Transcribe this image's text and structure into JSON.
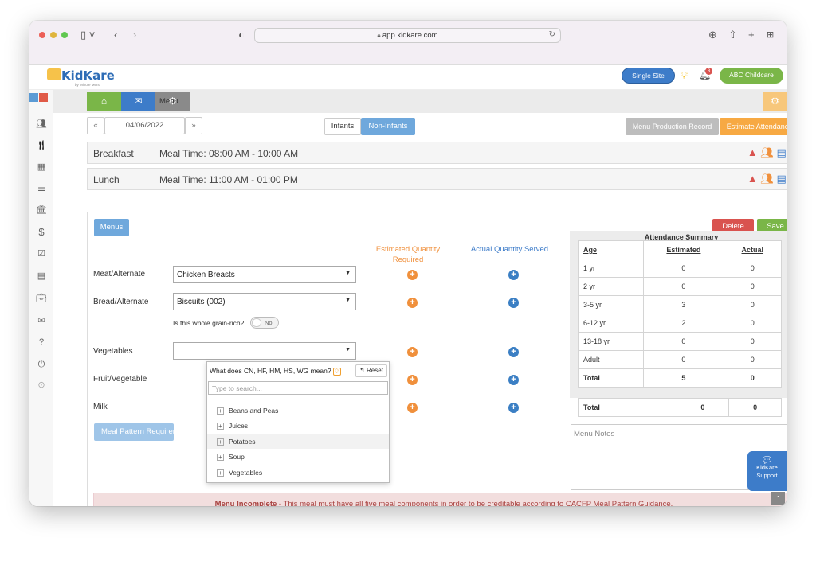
{
  "browser": {
    "url": "app.kidkare.com"
  },
  "header": {
    "logo": "KidKare",
    "logo_sub": "by Minute Menu",
    "single_site_label": "Single Site",
    "notification_count": "3",
    "childcare_label": "ABC Childcare"
  },
  "nav": {
    "menu_label": "Menu"
  },
  "toolbar": {
    "prev": "«",
    "date": "04/06/2022",
    "next": "»",
    "infants_label": "Infants",
    "noninfants_label": "Non-Infants",
    "production_record_label": "Menu Production Record",
    "estimate_attendance_label": "Estimate Attendance"
  },
  "breakfast": {
    "title": "Breakfast",
    "time": "Meal Time: 08:00 AM - 10:00 AM"
  },
  "lunch": {
    "title": "Lunch",
    "time": "Meal Time: 11:00 AM - 01:00 PM",
    "menus_button": "Menus",
    "delete_button": "Delete",
    "save_button": "Save",
    "col_estimated": "Estimated Quantity Required",
    "col_actual": "Actual Quantity Served",
    "components": [
      {
        "label": "Meat/Alternate",
        "value": "Chicken Breasts"
      },
      {
        "label": "Bread/Alternate",
        "value": "Biscuits (002)"
      },
      {
        "label": "Vegetables",
        "value": ""
      },
      {
        "label": "Fruit/Vegetable",
        "value": ""
      },
      {
        "label": "Milk",
        "value": ""
      }
    ],
    "whole_grain_question": "Is this whole grain-rich?",
    "whole_grain_toggle": "No",
    "meal_pattern_button": "Meal Pattern Requirements"
  },
  "dropdown": {
    "help_text": "What does CN, HF, HM, HS, WG mean?",
    "reset_label": "Reset",
    "search_placeholder": "Type to search...",
    "items": [
      "Beans and Peas",
      "Juices",
      "Potatoes",
      "Soup",
      "Vegetables"
    ]
  },
  "attendance": {
    "title": "Attendance Summary",
    "headers": [
      "Age",
      "Estimated",
      "Actual"
    ],
    "rows": [
      {
        "age": "1 yr",
        "estimated": "0",
        "actual": "0"
      },
      {
        "age": "2 yr",
        "estimated": "0",
        "actual": "0"
      },
      {
        "age": "3-5 yr",
        "estimated": "3",
        "actual": "0"
      },
      {
        "age": "6-12 yr",
        "estimated": "2",
        "actual": "0"
      },
      {
        "age": "13-18 yr",
        "estimated": "0",
        "actual": "0"
      },
      {
        "age": "Adult",
        "estimated": "0",
        "actual": "0"
      }
    ],
    "total": {
      "age": "Total",
      "estimated": "5",
      "actual": "0"
    },
    "total2": {
      "age": "Total",
      "estimated": "0",
      "actual": "0"
    }
  },
  "notes_placeholder": "Menu Notes",
  "alert": {
    "bold": "Menu Incomplete",
    "text": " - This meal must have all five meal components in order to be creditable according to CACFP Meal Pattern Guidance."
  },
  "support": {
    "line1": "KidKare",
    "line2": "Support"
  },
  "colors": {
    "green": "#7ab648",
    "blue": "#3d7cc9",
    "orange": "#f7a943",
    "gray_btn": "#bdbdbd",
    "alert_bg": "#f2dede",
    "alert_text": "#a94442"
  }
}
